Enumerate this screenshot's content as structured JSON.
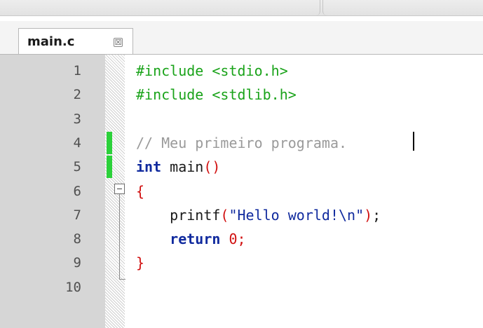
{
  "editor": {
    "active_tab": {
      "label": "main.c",
      "close_glyph": "☒",
      "close_icon": "tab-close-icon"
    },
    "line_numbers": [
      "1",
      "2",
      "3",
      "4",
      "5",
      "6",
      "7",
      "8",
      "9",
      "10"
    ],
    "lines": [
      {
        "tokens": [
          {
            "t": "#include <stdio.h>",
            "k": "pre"
          }
        ]
      },
      {
        "tokens": [
          {
            "t": "#include <stdlib.h>",
            "k": "pre"
          }
        ]
      },
      {
        "tokens": []
      },
      {
        "tokens": [
          {
            "t": "// Meu primeiro programa.",
            "k": "com"
          }
        ]
      },
      {
        "tokens": [
          {
            "t": "int",
            "k": "kw"
          },
          {
            "t": " main",
            "k": "id"
          },
          {
            "t": "()",
            "k": "paren"
          }
        ]
      },
      {
        "tokens": [
          {
            "t": "{",
            "k": "brace"
          }
        ]
      },
      {
        "tokens": [
          {
            "t": "    printf",
            "k": "id"
          },
          {
            "t": "(",
            "k": "paren"
          },
          {
            "t": "\"Hello world!\\n\"",
            "k": "str"
          },
          {
            "t": ")",
            "k": "paren"
          },
          {
            "t": ";",
            "k": "punc"
          }
        ]
      },
      {
        "tokens": [
          {
            "t": "    return",
            "k": "kw"
          },
          {
            "t": " ",
            "k": "id"
          },
          {
            "t": "0",
            "k": "num"
          },
          {
            "t": ";",
            "k": "num"
          }
        ]
      },
      {
        "tokens": [
          {
            "t": "}",
            "k": "brace"
          }
        ]
      },
      {
        "tokens": []
      }
    ],
    "changed_lines": [
      4,
      5
    ],
    "fold_marker_line": 6,
    "caret_line": 4,
    "colors": {
      "preprocessor": "#1aa31a",
      "comment": "#9a9a9a",
      "keyword": "#102a9e",
      "brace": "#d11010",
      "string": "#102a9e",
      "change_marker": "#2bd13a",
      "gutter": "#d6d6d6"
    }
  }
}
